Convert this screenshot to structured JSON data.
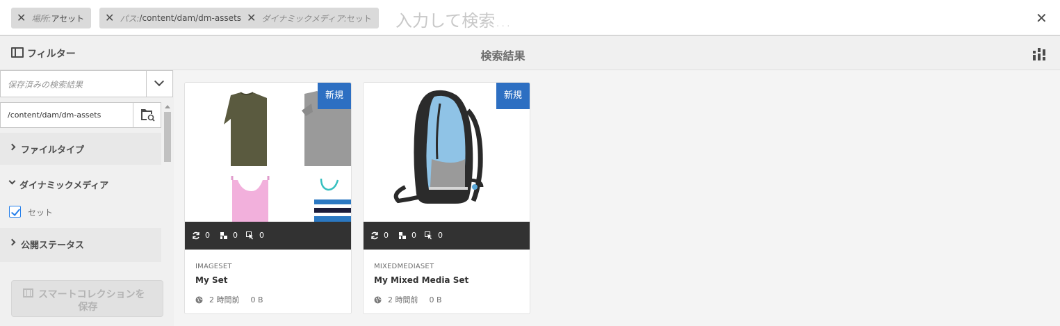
{
  "omnisearch": {
    "tags": [
      {
        "key": "場所:",
        "value": "アセット"
      },
      {
        "key": "パス:",
        "value": "/content/dam/dm-assets"
      },
      {
        "key": "ダイナミックメディア:",
        "value": "セット"
      }
    ],
    "placeholder": "入力して検索..."
  },
  "header": {
    "filter_title": "フィルター",
    "page_title": "検索結果"
  },
  "rail": {
    "saved_search_placeholder": "保存済みの検索結果",
    "path_value": "/content/dam/dm-assets",
    "sections": [
      {
        "label": "ファイルタイプ",
        "expanded": false
      },
      {
        "label": "ダイナミックメディア",
        "expanded": true
      },
      {
        "label": "公開ステータス",
        "expanded": false
      }
    ],
    "dynamic_media_option": {
      "label": "セット",
      "checked": true
    },
    "save_collection_line1": "スマートコレクションを",
    "save_collection_line2": "保存"
  },
  "cards": [
    {
      "badge": "新規",
      "stats": [
        "0",
        "0",
        "0"
      ],
      "type": "IMAGESET",
      "name": "My Set",
      "time": "2 時間前",
      "size": "0 B"
    },
    {
      "badge": "新規",
      "stats": [
        "0",
        "0",
        "0"
      ],
      "type": "MIXEDMEDIASET",
      "name": "My Mixed Media Set",
      "time": "2 時間前",
      "size": "0 B"
    }
  ],
  "colors": {
    "badge": "#2d6fc2",
    "checkbox": "#2680eb",
    "stats_bar": "#323232"
  }
}
